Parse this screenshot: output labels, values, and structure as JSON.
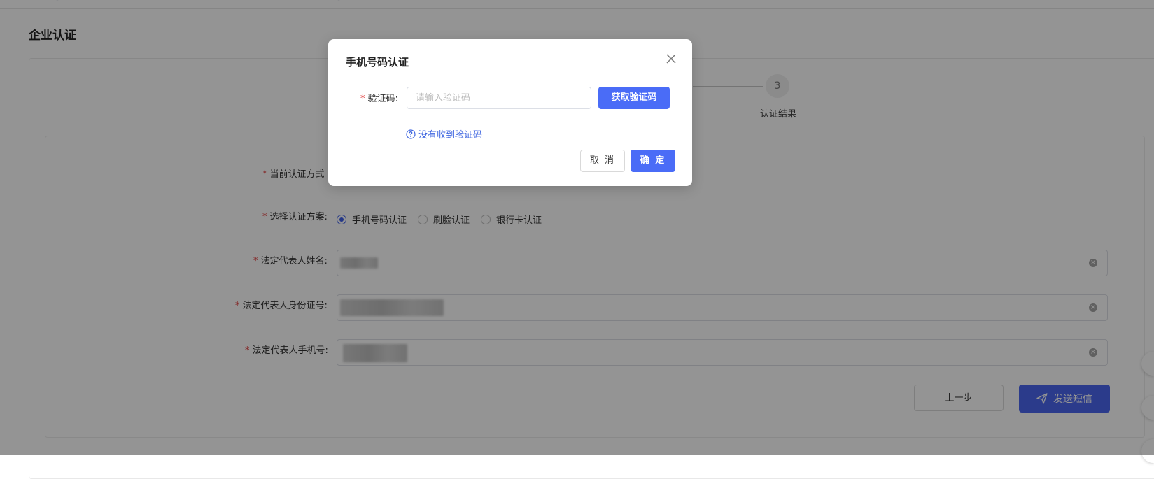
{
  "page": {
    "title": "企业认证"
  },
  "steps": {
    "step3_number": "3",
    "step3_label": "认证结果"
  },
  "form": {
    "current_method_label": "当前认证方式",
    "scheme_label": "选择认证方案:",
    "scheme_options": [
      "手机号码认证",
      "刷脸认证",
      "银行卡认证"
    ],
    "scheme_selected": "手机号码认证",
    "legal_name_label": "法定代表人姓名:",
    "legal_id_label": "法定代表人身份证号:",
    "legal_phone_label": "法定代表人手机号:",
    "prev_button": "上一步",
    "send_button": "发送短信",
    "required_mark": "*"
  },
  "dialog": {
    "title": "手机号码认证",
    "code_label": "验证码:",
    "code_placeholder": "请输入验证码",
    "get_code_button": "获取验证码",
    "help_link": "没有收到验证码",
    "cancel_button": "取 消",
    "ok_button": "确 定"
  },
  "colors": {
    "primary": "#4a6cf7",
    "required": "#e23c3c",
    "link": "#3f66e0",
    "overlay": "rgba(0,0,0,0.42)"
  },
  "icons": {
    "close": "close-icon",
    "help": "question-circle-icon",
    "send": "paper-plane-icon",
    "clear": "clear-circle-icon"
  }
}
